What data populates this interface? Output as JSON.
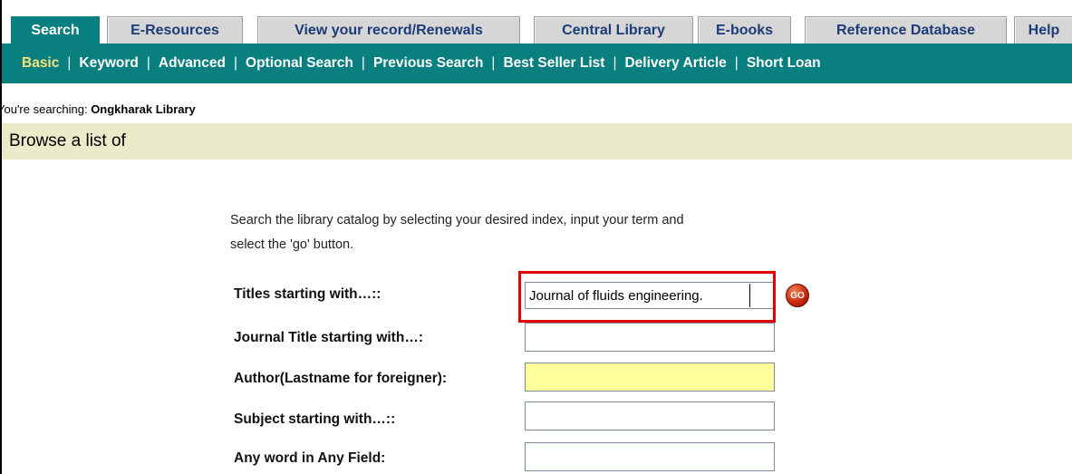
{
  "tabs": [
    {
      "label": "Search",
      "active": true
    },
    {
      "label": "E-Resources",
      "active": false
    },
    {
      "label": "View your record/Renewals",
      "active": false
    },
    {
      "label": "Central Library",
      "active": false
    },
    {
      "label": "E-books",
      "active": false
    },
    {
      "label": "Reference Database",
      "active": false
    },
    {
      "label": "Help",
      "active": false
    }
  ],
  "subnav": {
    "items": [
      {
        "label": "Basic",
        "current": true
      },
      {
        "label": "Keyword",
        "current": false
      },
      {
        "label": "Advanced",
        "current": false
      },
      {
        "label": "Optional Search",
        "current": false
      },
      {
        "label": "Previous Search",
        "current": false
      },
      {
        "label": "Best Seller List",
        "current": false
      },
      {
        "label": "Delivery Article",
        "current": false
      },
      {
        "label": "Short Loan",
        "current": false
      }
    ],
    "separator": "|"
  },
  "searching": {
    "prefix": "You're searching: ",
    "library": "Ongkharak Library"
  },
  "browse": {
    "title": "Browse a list of"
  },
  "instructions": {
    "line1": "Search the library catalog by selecting your desired index, input your term and",
    "line2": "select the 'go' button."
  },
  "form": {
    "rows": [
      {
        "label": "Titles starting with…::",
        "value": "Journal of fluids engineering."
      },
      {
        "label": "Journal Title starting with…:",
        "value": ""
      },
      {
        "label": "Author(Lastname for foreigner):",
        "value": ""
      },
      {
        "label": "Subject starting with…::",
        "value": ""
      },
      {
        "label": "Any word in Any Field:",
        "value": ""
      }
    ],
    "go_label": "GO"
  },
  "colors": {
    "tab_active": "#0a7f80",
    "tab_inactive": "#d6d6d6",
    "subnav_bg": "#0a7f80",
    "subnav_current": "#f7e27a",
    "browse_bg": "#ecebc9",
    "author_field_bg": "#ffff9c",
    "highlight": "#e00000",
    "go_button": "#c82a10"
  }
}
